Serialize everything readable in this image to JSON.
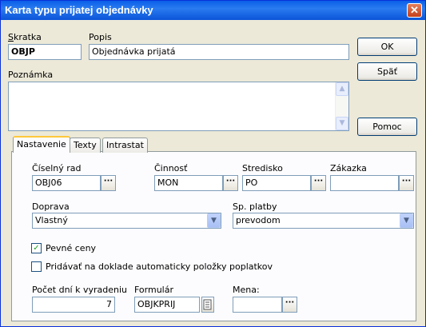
{
  "window": {
    "title": "Karta typu prijatej objednávky",
    "close_glyph": "✕"
  },
  "header": {
    "skratka_label": "Skratka",
    "skratka_value": "OBJP",
    "popis_label": "Popis",
    "popis_value": "Objednávka prijatá",
    "poznamka_label": "Poznámka"
  },
  "buttons": {
    "ok": "OK",
    "spat": "Späť",
    "pomoc": "Pomoc"
  },
  "tabs": [
    {
      "label": "Nastavenie",
      "active": true
    },
    {
      "label": "Texty",
      "active": false
    },
    {
      "label": "Intrastat",
      "active": false
    }
  ],
  "nastavenie": {
    "ciselny_rad_label": "Číselný rad",
    "ciselny_rad_value": "OBJ06",
    "cinnost_label": "Činnosť",
    "cinnost_value": "MON",
    "stredisko_label": "Stredisko",
    "stredisko_value": "PO",
    "zakazka_label": "Zákazka",
    "zakazka_value": "",
    "doprava_label": "Doprava",
    "doprava_value": "Vlastný",
    "sp_platby_label": "Sp. platby",
    "sp_platby_value": "prevodom",
    "pevne_ceny_label": "Pevné ceny",
    "pevne_ceny_checked": true,
    "pridavat_label": "Pridávať na doklade automaticky položky poplatkov",
    "pridavat_checked": false,
    "pocet_dni_label": "Počet dní k vyradeniu",
    "pocet_dni_value": "7",
    "formular_label": "Formulár",
    "formular_value": "OBJKPRIJ",
    "mena_label": "Mena:",
    "mena_value": ""
  },
  "glyphs": {
    "ellipsis": "···",
    "dropdown": "▼",
    "scroll_up": "▲",
    "scroll_down": "▼",
    "check": "✓"
  }
}
